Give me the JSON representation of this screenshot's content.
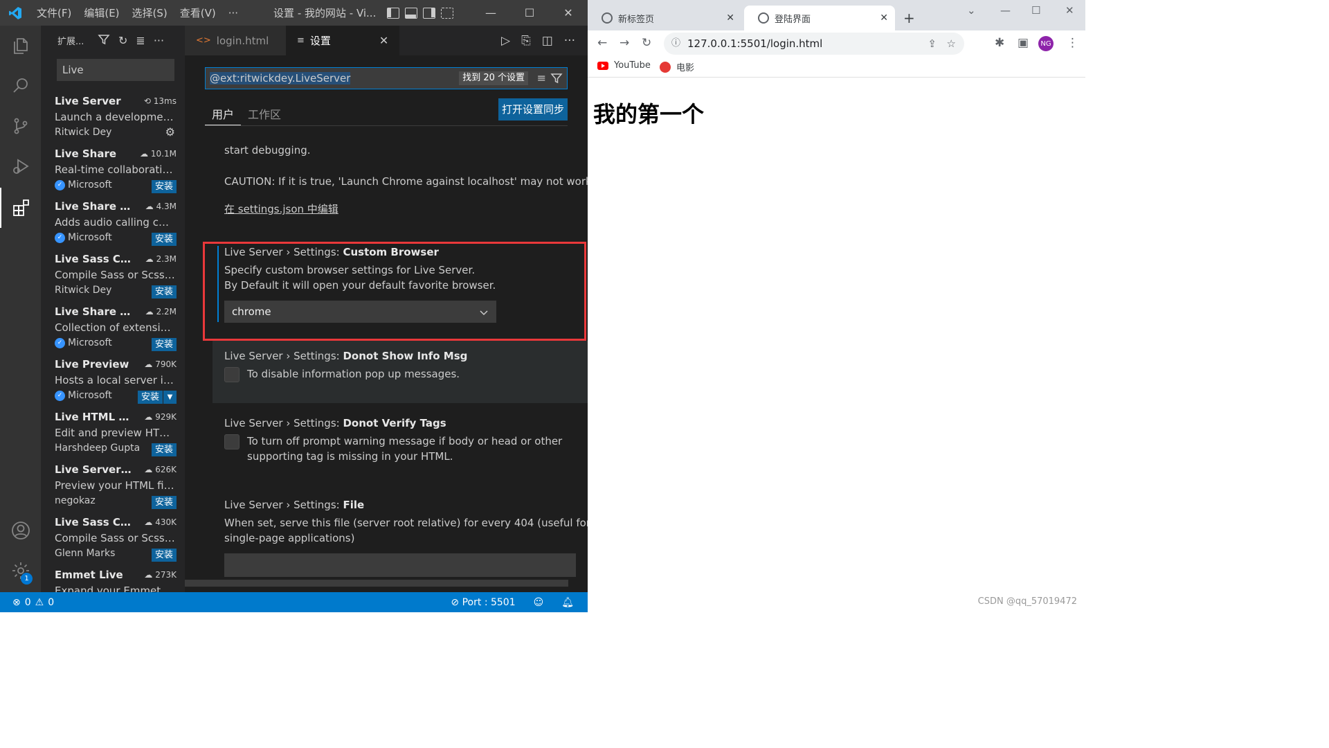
{
  "vscode": {
    "menu": [
      "文件(F)",
      "编辑(E)",
      "选择(S)",
      "查看(V)",
      "···"
    ],
    "window_title": "设置 - 我的网站 - Vi...",
    "sidebar": {
      "title": "扩展...",
      "search_value": "Live",
      "extensions": [
        {
          "name": "Live Server",
          "stat": "13ms",
          "desc": "Launch a development...",
          "publisher": "Ritwick Dey",
          "verified": false,
          "action": ""
        },
        {
          "name": "Live Share",
          "stat": "10.1M",
          "desc": "Real-time collaborative...",
          "publisher": "Microsoft",
          "verified": true,
          "action": "安装"
        },
        {
          "name": "Live Share A...",
          "stat": "4.3M",
          "desc": "Adds audio calling cap...",
          "publisher": "Microsoft",
          "verified": true,
          "action": "安装"
        },
        {
          "name": "Live Sass Co...",
          "stat": "2.3M",
          "desc": "Compile Sass or Scss t...",
          "publisher": "Ritwick Dey",
          "verified": false,
          "action": "安装"
        },
        {
          "name": "Live Share Ex...",
          "stat": "2.2M",
          "desc": "Collection of extension...",
          "publisher": "Microsoft",
          "verified": true,
          "action": "安装"
        },
        {
          "name": "Live Preview",
          "stat": "790K",
          "desc": "Hosts a local server in ...",
          "publisher": "Microsoft",
          "verified": true,
          "action": "安装"
        },
        {
          "name": "Live HTML P...",
          "stat": "929K",
          "desc": "Edit and preview HTML...",
          "publisher": "Harshdeep Gupta",
          "verified": false,
          "action": "安装"
        },
        {
          "name": "Live Server P...",
          "stat": "626K",
          "desc": "Preview your HTML file...",
          "publisher": "negokaz",
          "verified": false,
          "action": "安装"
        },
        {
          "name": "Live Sass Co...",
          "stat": "430K",
          "desc": "Compile Sass or Scss t...",
          "publisher": "Glenn Marks",
          "verified": false,
          "action": "安装"
        },
        {
          "name": "Emmet Live",
          "stat": "273K",
          "desc": "Expand your Emmet ab...",
          "publisher": "",
          "verified": false,
          "action": ""
        }
      ]
    },
    "activity_badge": "1",
    "tabs": [
      {
        "label": "login.html"
      },
      {
        "label": "设置"
      }
    ],
    "settings": {
      "search_value": "@ext:ritwickdey.LiveServer",
      "found_label": "找到 20 个设置",
      "scope_user": "用户",
      "scope_workspace": "工作区",
      "sync_button": "打开设置同步",
      "top_text": "start debugging.",
      "caution_text": "CAUTION: If it is true, 'Launch Chrome against localhost' may not work.",
      "edit_link": "在 settings.json 中编辑",
      "items": [
        {
          "prefix": "Live Server › Settings: ",
          "name": "Custom Browser",
          "desc1": "Specify custom browser settings for Live Server.",
          "desc2": "By Default it will open your default favorite browser.",
          "value": "chrome"
        },
        {
          "prefix": "Live Server › Settings: ",
          "name": "Donot Show Info Msg",
          "desc1": "To disable information pop up messages."
        },
        {
          "prefix": "Live Server › Settings: ",
          "name": "Donot Verify Tags",
          "desc1": "To turn off prompt warning message if body or head or other",
          "desc2": "supporting tag is missing in your HTML."
        },
        {
          "prefix": "Live Server › Settings: ",
          "name": "File",
          "desc1": "When set, serve this file (server root relative) for every 404 (useful for",
          "desc2": "single-page applications)"
        }
      ]
    },
    "status": {
      "errors": "0",
      "warnings": "0",
      "port": "Port : 5501"
    }
  },
  "browser": {
    "tabs": [
      {
        "title": "新标签页"
      },
      {
        "title": "登陆界面"
      }
    ],
    "url": "127.0.0.1:5501/login.html",
    "profile": "NG",
    "bookmarks": [
      "YouTube",
      "电影"
    ],
    "page_heading": "我的第一个"
  },
  "watermark": "CSDN @qq_57019472"
}
